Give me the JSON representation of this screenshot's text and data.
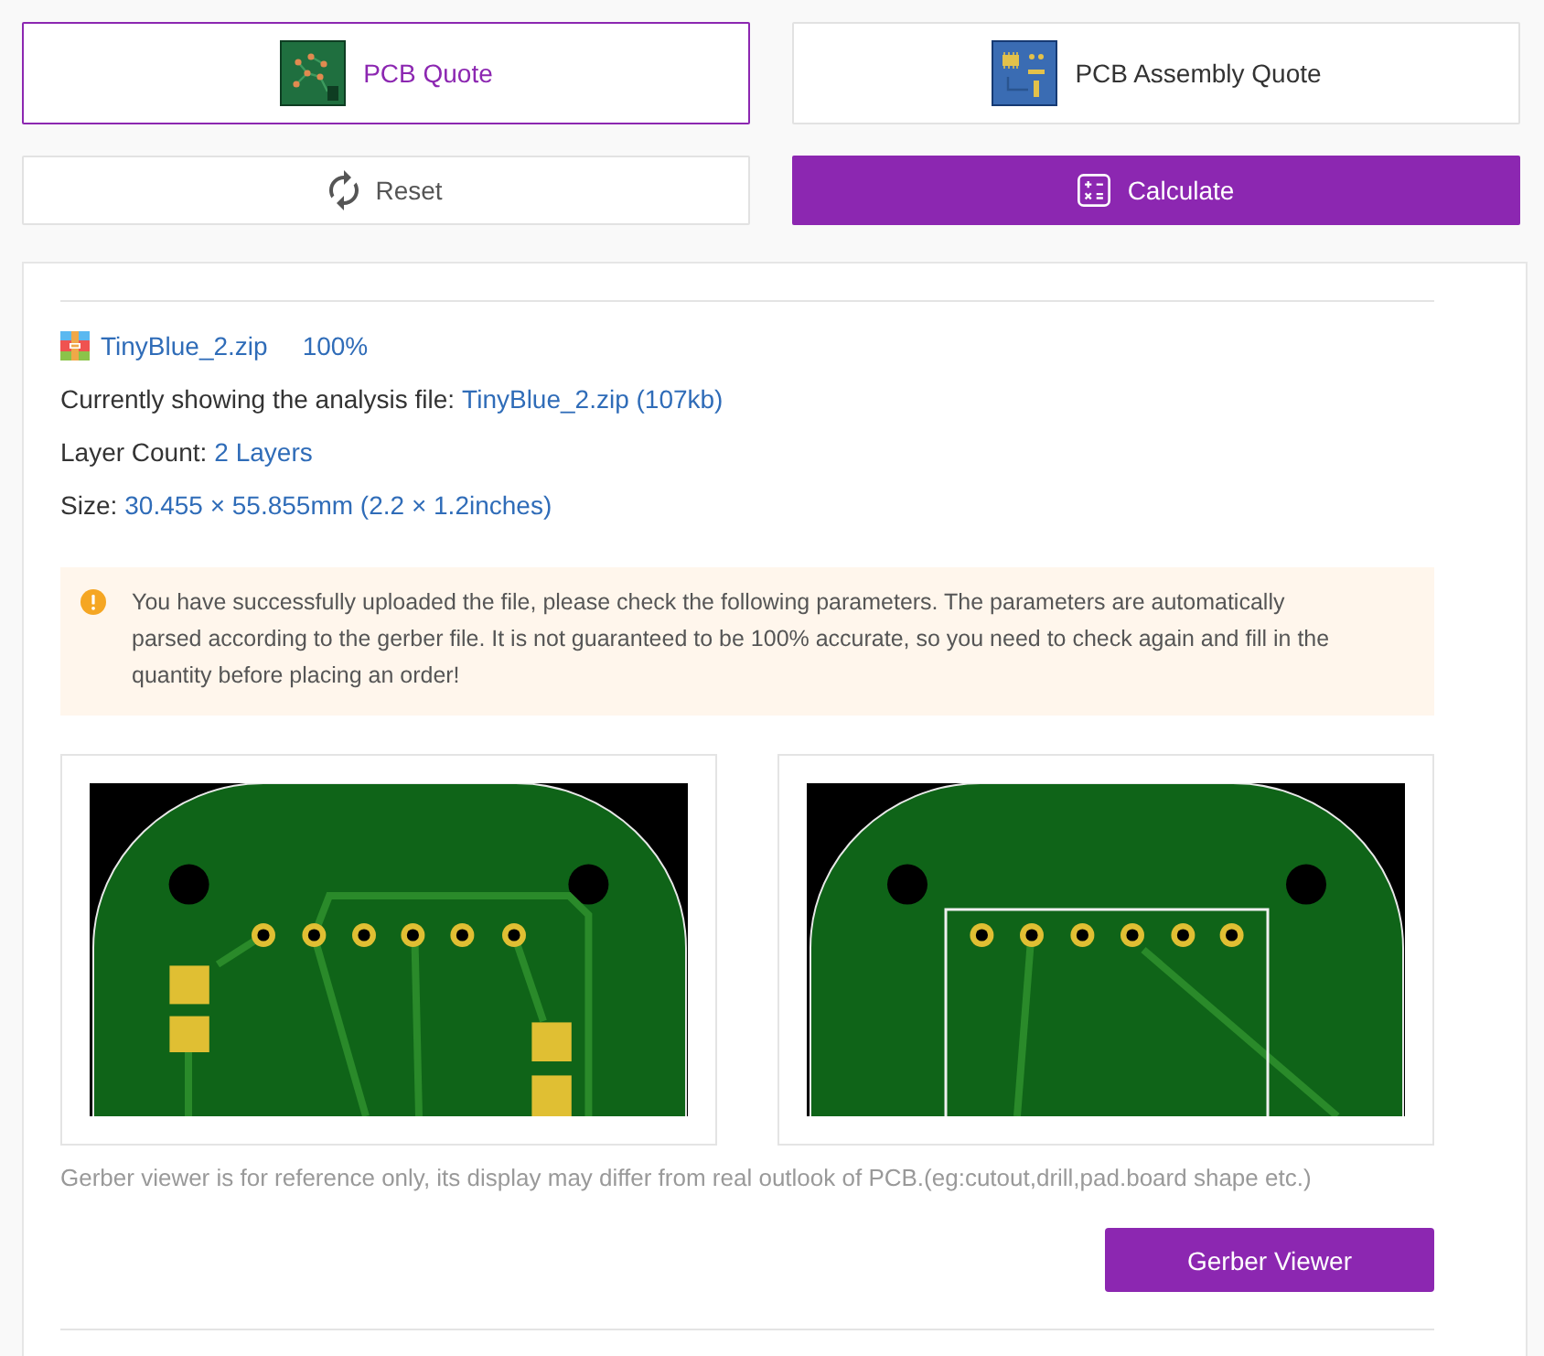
{
  "quote_tabs": [
    {
      "label": "PCB Quote",
      "selected": true,
      "kind": "pcb"
    },
    {
      "label": "PCB Assembly Quote",
      "selected": false,
      "kind": "assembly"
    }
  ],
  "actions": [
    {
      "label": "Reset",
      "kind": "reset"
    },
    {
      "label": "Calculate",
      "kind": "calculate"
    }
  ],
  "file": {
    "name": "TinyBlue_2.zip",
    "status": "100%"
  },
  "details": [
    {
      "label": "Currently showing the analysis file:",
      "value": "TinyBlue_2.zip (107kb)"
    },
    {
      "label": "Layer Count:",
      "value": "2 Layers"
    },
    {
      "label": "Size:",
      "value": "30.455 × 55.855mm (2.2 × 1.2inches)"
    }
  ],
  "notice": {
    "text": "You have successfully uploaded the file, please check the following parameters. The parameters are automatically parsed according to the gerber file. It is not guaranteed to be 100% accurate, so you need to check again and fill in the quantity before placing an order!"
  },
  "previews": [
    {
      "kind": "top"
    },
    {
      "kind": "bottom"
    }
  ],
  "viewer_note": "Gerber viewer is for reference only, its display may differ from real outlook of PCB.(eg:cutout,drill,pad.board shape etc.)",
  "viewer_button": "Gerber Viewer"
}
